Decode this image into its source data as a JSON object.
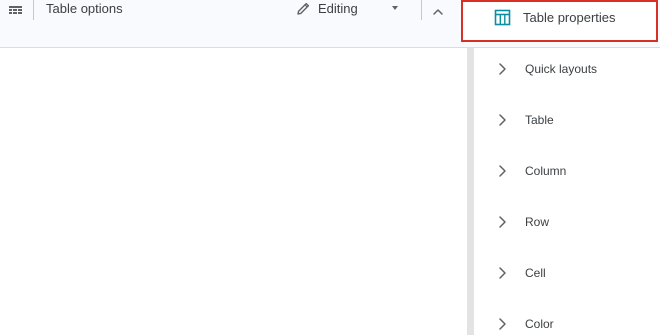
{
  "toolbar": {
    "table_options_label": "Table options",
    "editing_mode_label": "Editing"
  },
  "panel": {
    "title": "Table properties",
    "sections": [
      {
        "label": "Quick layouts"
      },
      {
        "label": "Table"
      },
      {
        "label": "Column"
      },
      {
        "label": "Row"
      },
      {
        "label": "Cell"
      },
      {
        "label": "Color"
      }
    ]
  },
  "icons": {
    "table_menu": "table-grid-icon",
    "editing": "pencil-icon",
    "dropdown": "caret-down-icon",
    "collapse": "chevron-up-icon",
    "properties": "table-icon",
    "section_expand": "chevron-right-icon"
  },
  "colors": {
    "highlight_border": "#d93025",
    "icon_accent": "#0b8ea0",
    "toolbar_background": "#f8fafd"
  }
}
